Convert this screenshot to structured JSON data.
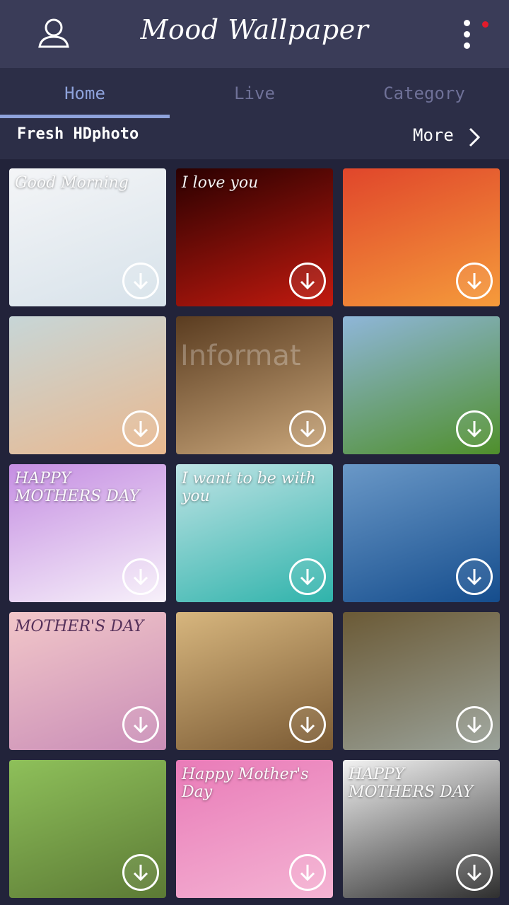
{
  "header": {
    "title": "Mood Wallpaper",
    "profile_icon": "person-icon",
    "menu_icon": "more-vertical-icon",
    "notification_color": "#e21b2b"
  },
  "tabs": [
    {
      "label": "Home",
      "active": true
    },
    {
      "label": "Live",
      "active": false
    },
    {
      "label": "Category",
      "active": false
    }
  ],
  "section": {
    "title": "Fresh HDphoto",
    "more_label": "More",
    "more_icon": "chevron-right-icon"
  },
  "wallpapers": [
    {
      "id": "good-morning",
      "caption": "Good Morning",
      "colors": [
        "#f4f5f7",
        "#d7e2ea"
      ]
    },
    {
      "id": "heart-locket",
      "caption": "I love you",
      "colors": [
        "#2a0000",
        "#c21a0f"
      ]
    },
    {
      "id": "rose-basket",
      "caption": "",
      "colors": [
        "#e0462b",
        "#f59b3b"
      ]
    },
    {
      "id": "finger-faces",
      "caption": "",
      "colors": [
        "#c7d6d7",
        "#e9b88f"
      ]
    },
    {
      "id": "girl-portrait",
      "caption": "",
      "colors": [
        "#5a3c20",
        "#caa77b"
      ]
    },
    {
      "id": "green-valley",
      "caption": "",
      "colors": [
        "#8fb6d9",
        "#4f8f2b"
      ]
    },
    {
      "id": "purple-roses",
      "caption": "HAPPY MOTHERS DAY",
      "colors": [
        "#c58ee2",
        "#f7f1fa"
      ]
    },
    {
      "id": "forever-gift",
      "caption": "I want to be with you",
      "colors": [
        "#bfe3e5",
        "#2fb3ab"
      ]
    },
    {
      "id": "paragliders",
      "caption": "",
      "colors": [
        "#6a98c7",
        "#154d8d"
      ]
    },
    {
      "id": "mothers-day-card",
      "caption": "MOTHER'S DAY",
      "colors": [
        "#f2c7c9",
        "#c98db7"
      ]
    },
    {
      "id": "girl-guitar",
      "caption": "",
      "colors": [
        "#d7b67e",
        "#7a5a34"
      ]
    },
    {
      "id": "kids-flowers",
      "caption": "",
      "colors": [
        "#6b5a36",
        "#9aa29a"
      ]
    },
    {
      "id": "lion-cub",
      "caption": "",
      "colors": [
        "#8ec05a",
        "#5c7a35"
      ]
    },
    {
      "id": "mothers-hearts",
      "caption": "Happy Mother's Day",
      "colors": [
        "#e97bb8",
        "#f4b3d3"
      ]
    },
    {
      "id": "mother-silhouette",
      "caption": "HAPPY MOTHERS DAY",
      "colors": [
        "#f2f2f2",
        "#2f2f2f"
      ]
    }
  ],
  "watermark": {
    "text": "Informat"
  }
}
